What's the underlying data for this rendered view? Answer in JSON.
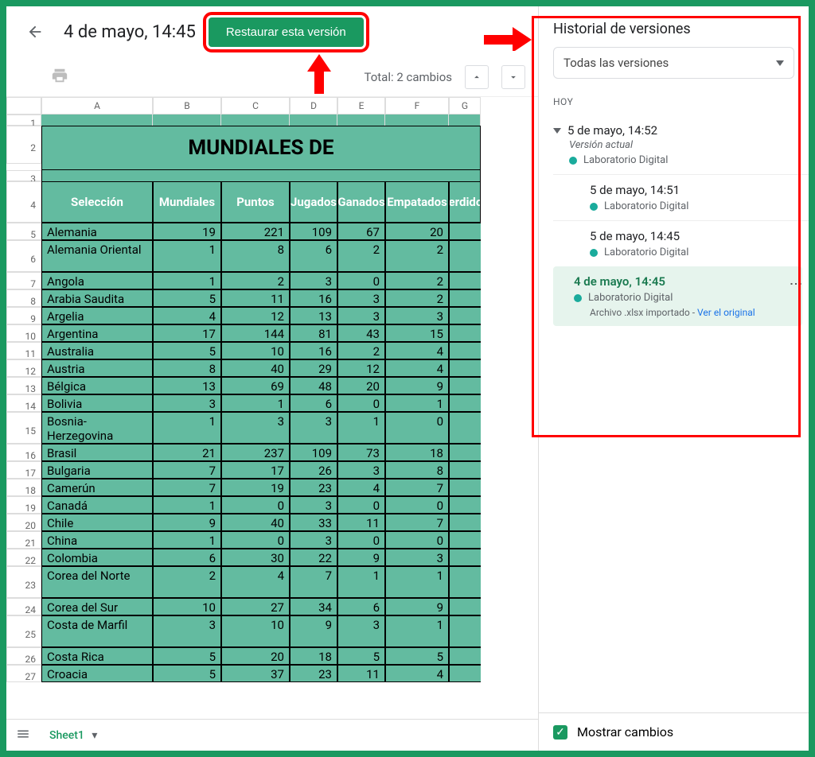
{
  "topbar": {
    "version_title": "4 de mayo, 14:45",
    "restore_label": "Restaurar esta versión"
  },
  "changes_bar": {
    "total_label": "Total: 2 cambios"
  },
  "sheet": {
    "title": "MUNDIALES DE",
    "columns": [
      "A",
      "B",
      "C",
      "D",
      "E",
      "F",
      "G"
    ],
    "headers": [
      "Selección",
      "Mundiales",
      "Puntos",
      "Jugados",
      "Ganados",
      "Empatados",
      "Perdidos"
    ],
    "rows": [
      {
        "n": 5,
        "team": "Alemania",
        "v": [
          "19",
          "221",
          "109",
          "67",
          "20",
          ""
        ]
      },
      {
        "n": 6,
        "team": "Alemania Oriental",
        "v": [
          "1",
          "8",
          "6",
          "2",
          "2",
          ""
        ]
      },
      {
        "n": 7,
        "team": "Angola",
        "v": [
          "1",
          "2",
          "3",
          "0",
          "2",
          ""
        ]
      },
      {
        "n": 8,
        "team": "Arabia Saudita",
        "v": [
          "5",
          "11",
          "16",
          "3",
          "2",
          ""
        ]
      },
      {
        "n": 9,
        "team": "Argelia",
        "v": [
          "4",
          "12",
          "13",
          "3",
          "3",
          ""
        ]
      },
      {
        "n": 10,
        "team": "Argentina",
        "v": [
          "17",
          "144",
          "81",
          "43",
          "15",
          ""
        ]
      },
      {
        "n": 11,
        "team": "Australia",
        "v": [
          "5",
          "10",
          "16",
          "2",
          "4",
          ""
        ]
      },
      {
        "n": 12,
        "team": "Austria",
        "v": [
          "8",
          "40",
          "29",
          "12",
          "4",
          ""
        ]
      },
      {
        "n": 13,
        "team": "Bélgica",
        "v": [
          "13",
          "69",
          "48",
          "20",
          "9",
          ""
        ]
      },
      {
        "n": 14,
        "team": "Bolivia",
        "v": [
          "3",
          "1",
          "6",
          "0",
          "1",
          ""
        ]
      },
      {
        "n": 15,
        "team": "Bosnia-Herzegovina",
        "v": [
          "1",
          "3",
          "3",
          "1",
          "0",
          ""
        ]
      },
      {
        "n": 16,
        "team": "Brasil",
        "v": [
          "21",
          "237",
          "109",
          "73",
          "18",
          ""
        ]
      },
      {
        "n": 17,
        "team": "Bulgaria",
        "v": [
          "7",
          "17",
          "26",
          "3",
          "8",
          ""
        ]
      },
      {
        "n": 18,
        "team": "Camerún",
        "v": [
          "7",
          "19",
          "23",
          "4",
          "7",
          ""
        ]
      },
      {
        "n": 19,
        "team": "Canadá",
        "v": [
          "1",
          "0",
          "3",
          "0",
          "0",
          ""
        ]
      },
      {
        "n": 20,
        "team": "Chile",
        "v": [
          "9",
          "40",
          "33",
          "11",
          "7",
          ""
        ]
      },
      {
        "n": 21,
        "team": "China",
        "v": [
          "1",
          "0",
          "3",
          "0",
          "0",
          ""
        ]
      },
      {
        "n": 22,
        "team": "Colombia",
        "v": [
          "6",
          "30",
          "22",
          "9",
          "3",
          ""
        ]
      },
      {
        "n": 23,
        "team": "Corea del Norte",
        "v": [
          "2",
          "4",
          "7",
          "1",
          "1",
          ""
        ]
      },
      {
        "n": 24,
        "team": "Corea del Sur",
        "v": [
          "10",
          "27",
          "34",
          "6",
          "9",
          ""
        ]
      },
      {
        "n": 25,
        "team": "Costa de Marfil",
        "v": [
          "3",
          "10",
          "9",
          "3",
          "1",
          ""
        ]
      },
      {
        "n": 26,
        "team": "Costa Rica",
        "v": [
          "5",
          "20",
          "18",
          "5",
          "5",
          ""
        ]
      },
      {
        "n": 27,
        "team": "Croacia",
        "v": [
          "5",
          "37",
          "23",
          "11",
          "4",
          ""
        ]
      }
    ]
  },
  "sheet_tab": {
    "name": "Sheet1",
    "dropdown_icon": "▾"
  },
  "panel": {
    "title": "Historial de versiones",
    "dropdown": "Todas las versiones",
    "day": "HOY",
    "versions": {
      "current_date": "5 de mayo, 14:52",
      "current_label": "Versión actual",
      "author": "Laboratorio Digital",
      "v2": "5 de mayo, 14:51",
      "v3": "5 de mayo, 14:45",
      "selected": "4 de mayo, 14:45",
      "import_note": "Archivo .xlsx importado",
      "import_link": "Ver el original"
    },
    "show_changes": "Mostrar cambios"
  }
}
